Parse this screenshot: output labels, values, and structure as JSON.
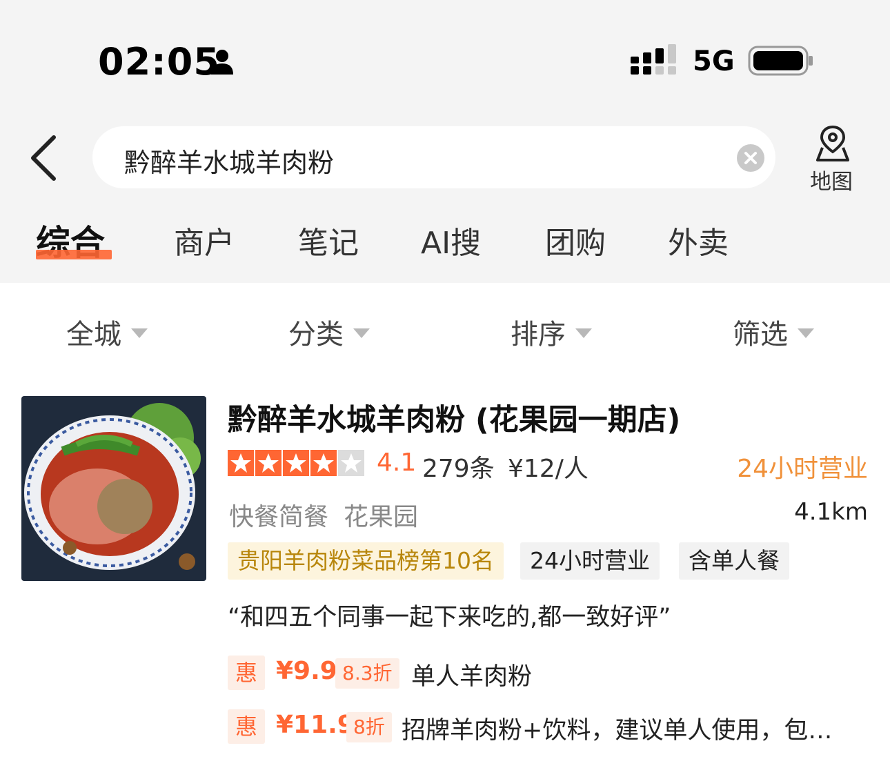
{
  "status_bar": {
    "time": "02:05",
    "network": "5G",
    "icons": [
      "person-icon",
      "signal-icon",
      "battery-icon"
    ]
  },
  "search": {
    "query": "黔醉羊水城羊肉粉",
    "map_label": "地图",
    "icons": [
      "back-arrow-icon",
      "clear-icon",
      "map-pin-icon"
    ]
  },
  "tabs": [
    {
      "label": "综合",
      "active": true
    },
    {
      "label": "商户"
    },
    {
      "label": "笔记"
    },
    {
      "label": "AI搜"
    },
    {
      "label": "团购"
    },
    {
      "label": "外卖"
    }
  ],
  "filters": [
    {
      "label": "全城"
    },
    {
      "label": "分类"
    },
    {
      "label": "排序"
    },
    {
      "label": "筛选"
    }
  ],
  "result": {
    "name": "黔醉羊水城羊肉粉 (花果园一期店)",
    "star_rating": 4.1,
    "rating": "4.1",
    "reviews": "279条",
    "price_per_person": "¥12/人",
    "hours": "24小时营业",
    "category": "快餐简餐",
    "area": "花果园",
    "distance": "4.1km",
    "tags": [
      "贵阳羊肉粉菜品榜第10名",
      "24小时营业",
      "含单人餐"
    ],
    "quote": "“和四五个同事一起下来吃的,都一致好评”",
    "deals": [
      {
        "badge": "惠",
        "price": "¥9.9",
        "discount": "8.3折",
        "desc": "单人羊肉粉"
      },
      {
        "badge": "惠",
        "price": "¥11.9",
        "discount": "8折",
        "desc": "招牌羊肉粉+饮料，建议单人使用，包…"
      }
    ]
  },
  "colors": {
    "accent": "#ff6633",
    "hours_orange": "#f0913a",
    "rank_tag_bg": "#fdf4dd",
    "rank_tag_text": "#b8860b",
    "background_top": "#f4f4f4"
  }
}
